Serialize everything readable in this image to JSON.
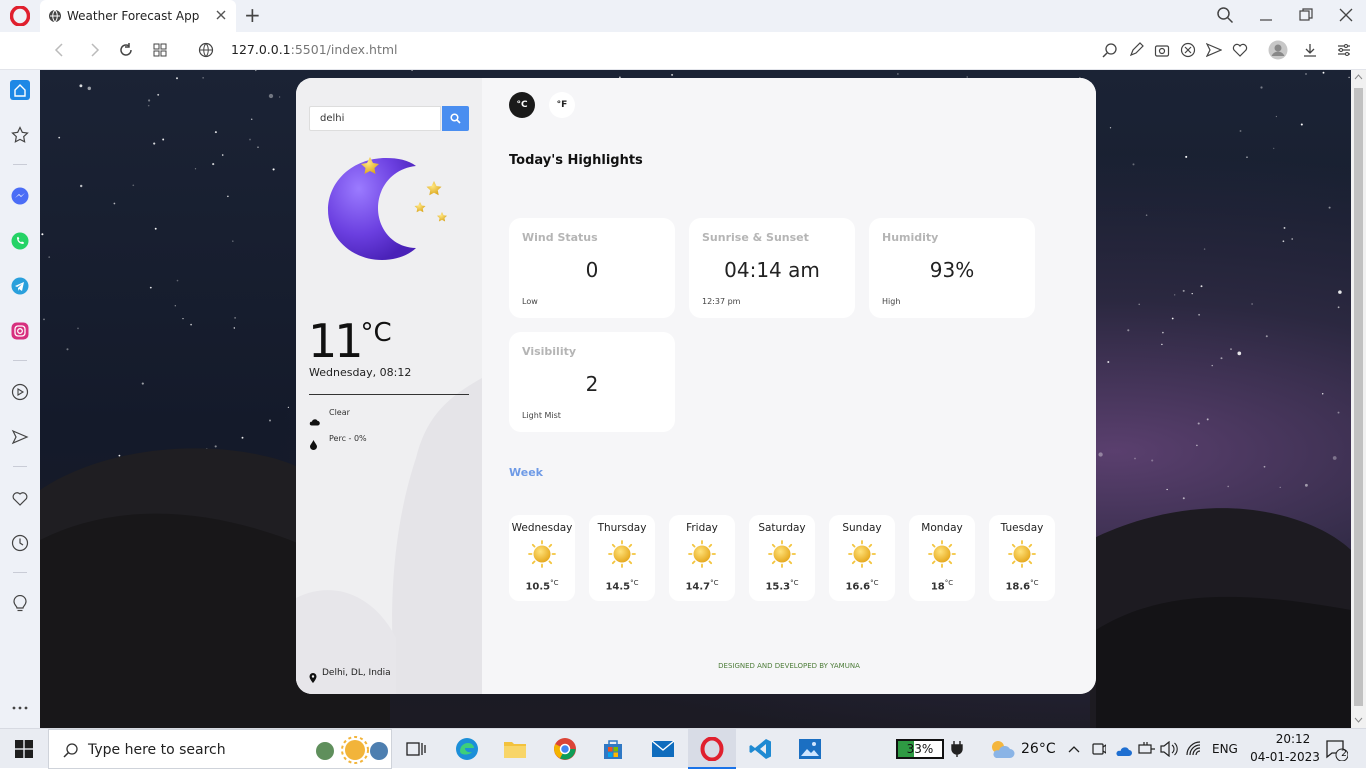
{
  "browser": {
    "tab_title": "Weather Forecast App",
    "new_tab": "+",
    "url_host": "127.0.0.1",
    "url_rest": ":5501/index.html"
  },
  "app": {
    "search": {
      "value": "delhi",
      "placeholder": ""
    },
    "temperature": {
      "value": "11",
      "unit": "°C"
    },
    "datetime": "Wednesday, 08:12",
    "condition": "Clear",
    "precipitation": "Perc - 0%",
    "location": "Delhi, DL, India",
    "unit_toggle": {
      "celsius": "°C",
      "fahrenheit": "°F"
    },
    "highlights_title": "Today's Highlights",
    "highlights": [
      {
        "title": "Wind Status",
        "value": "0",
        "sub": "Low"
      },
      {
        "title": "Sunrise & Sunset",
        "value": "04:14 am",
        "sub": "12:37 pm"
      },
      {
        "title": "Humidity",
        "value": "93%",
        "sub": "High"
      },
      {
        "title": "Visibility",
        "value": "2",
        "sub": "Light Mist"
      }
    ],
    "week_label": "Week",
    "week": [
      {
        "day": "Wednesday",
        "temp": "10.5",
        "unit": "°C"
      },
      {
        "day": "Thursday",
        "temp": "14.5",
        "unit": "°C"
      },
      {
        "day": "Friday",
        "temp": "14.7",
        "unit": "°C"
      },
      {
        "day": "Saturday",
        "temp": "15.3",
        "unit": "°C"
      },
      {
        "day": "Sunday",
        "temp": "16.6",
        "unit": "°C"
      },
      {
        "day": "Monday",
        "temp": "18",
        "unit": "°C"
      },
      {
        "day": "Tuesday",
        "temp": "18.6",
        "unit": "°C"
      }
    ],
    "footer": "DESIGNED AND DEVELOPED BY YAMUNA"
  },
  "taskbar": {
    "search_placeholder": "Type here to search",
    "battery": "33%",
    "weather_temp": "26°C",
    "language": "ENG",
    "time": "20:12",
    "date": "04-01-2023",
    "notifications": "2"
  },
  "colors": {
    "accent_blue": "#4a8ef0",
    "week_label": "#6e9ae6",
    "footer_green": "#4e7d3a"
  }
}
